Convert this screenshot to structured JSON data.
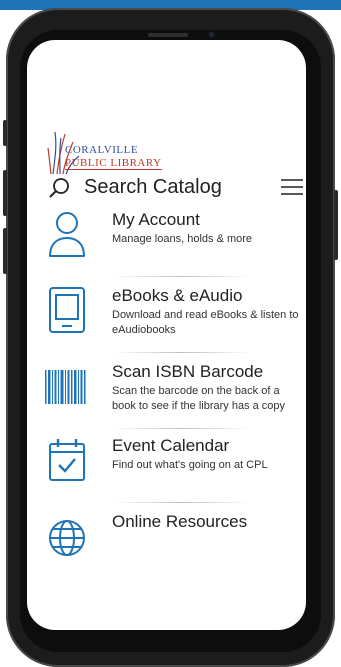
{
  "logo": {
    "line1": "CORALVILLE",
    "line2": "PUBLIC LIBRARY"
  },
  "search": {
    "label": "Search Catalog"
  },
  "menu": [
    {
      "title": "My Account",
      "desc": "Manage loans, holds & more",
      "icon": "person-icon"
    },
    {
      "title": "eBooks & eAudio",
      "desc": "Download and read eBooks & listen to eAudiobooks",
      "icon": "tablet-icon"
    },
    {
      "title": "Scan ISBN Barcode",
      "desc": "Scan the barcode on the back of a book to see if the library has a copy",
      "icon": "barcode-icon"
    },
    {
      "title": "Event Calendar",
      "desc": "Find out what's going on at CPL",
      "icon": "calendar-icon"
    },
    {
      "title": "Online Resources",
      "desc": "",
      "icon": "globe-icon"
    }
  ],
  "colors": {
    "accent": "#1f73b7",
    "text": "#222222",
    "logo_blue": "#2f4f9f",
    "logo_red": "#c0392b"
  }
}
